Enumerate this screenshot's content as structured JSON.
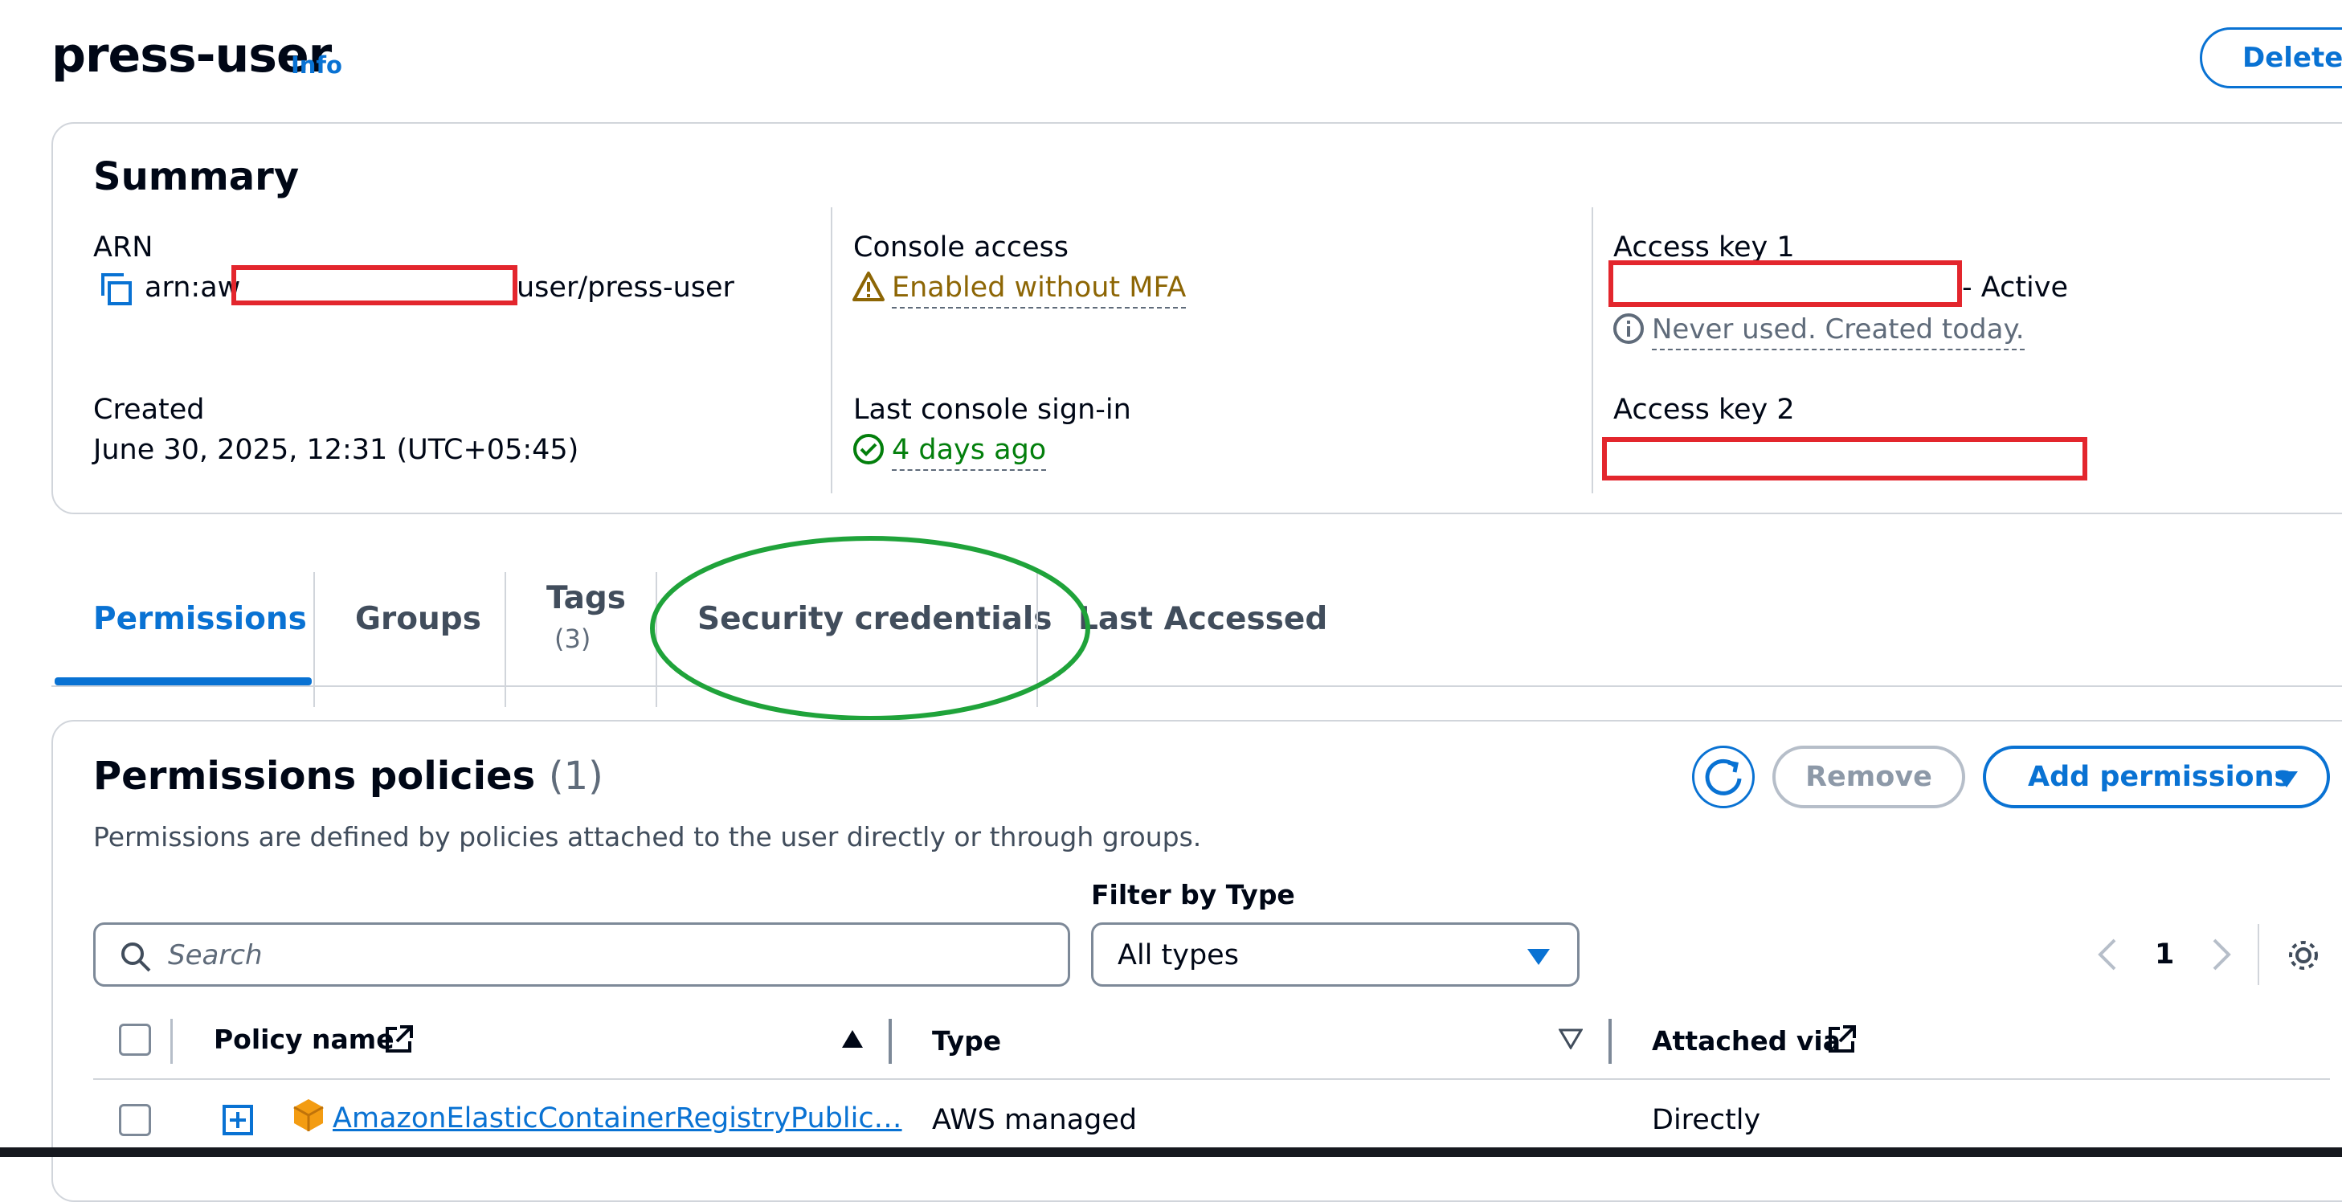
{
  "header": {
    "title": "press-user",
    "info": "Info",
    "delete_label": "Delete"
  },
  "summary": {
    "heading": "Summary",
    "arn_label": "ARN",
    "arn_prefix": "arn:aw",
    "arn_suffix": "user/press-user",
    "created_label": "Created",
    "created_value": "June 30, 2025, 12:31 (UTC+05:45)",
    "console_access_label": "Console access",
    "console_access_value": "Enabled without MFA",
    "last_signin_label": "Last console sign-in",
    "last_signin_value": "4 days ago",
    "access_key1_label": "Access key 1",
    "access_key1_status": "- Active",
    "access_key1_note": "Never used. Created today.",
    "access_key2_label": "Access key 2"
  },
  "tabs": [
    {
      "label": "Permissions"
    },
    {
      "label": "Groups"
    },
    {
      "label": "Tags",
      "count": "(3)"
    },
    {
      "label": "Security credentials"
    },
    {
      "label": "Last Accessed"
    }
  ],
  "permissions": {
    "heading": "Permissions policies",
    "count": "(1)",
    "description": "Permissions are defined by policies attached to the user directly or through groups.",
    "remove_label": "Remove",
    "add_label": "Add permissions",
    "filter_label": "Filter by Type",
    "search_placeholder": "Search",
    "filter_value": "All types",
    "page_number": "1",
    "columns": [
      "Policy name",
      "Type",
      "Attached via"
    ],
    "rows": [
      {
        "name": "AmazonElasticContainerRegistryPublic…",
        "type": "AWS managed",
        "attached": "Directly"
      }
    ]
  },
  "colors": {
    "accent": "#0972d3",
    "warning": "#8d6605",
    "success": "#037f0c",
    "redaction": "#e3262d",
    "annotation": "#1fa33a"
  },
  "icons": [
    "copy-icon",
    "warning-icon",
    "check-circle-icon",
    "info-circle-icon",
    "refresh-icon",
    "caret-down-icon",
    "search-icon",
    "chevron-left-icon",
    "chevron-right-icon",
    "gear-icon",
    "external-link-icon",
    "sort-ascending-icon",
    "sort-descending-icon",
    "expand-icon",
    "aws-package-icon"
  ]
}
